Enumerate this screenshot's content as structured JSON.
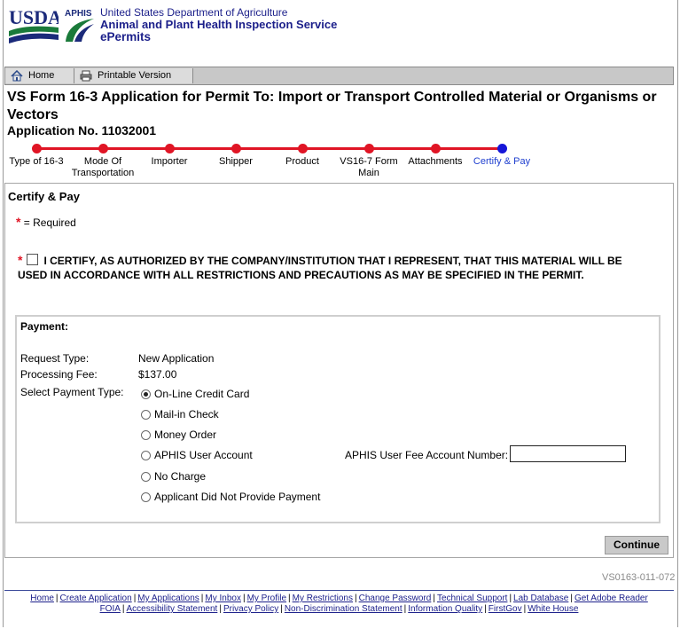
{
  "header": {
    "usda_logo_text": "USDA",
    "aphis_logo_text": "APHIS",
    "line1": "United States Department of Agriculture",
    "line2": "Animal and Plant Health Inspection Service",
    "line3": "ePermits"
  },
  "toolbar": {
    "home_label": "Home",
    "print_label": "Printable Version"
  },
  "page": {
    "title": "VS Form 16-3 Application for Permit To: Import or Transport Controlled Material or Organisms or Vectors",
    "application_no": "Application No. 11032001"
  },
  "steps": [
    {
      "label": "Type of 16-3",
      "current": false
    },
    {
      "label": "Mode Of Transportation",
      "current": false
    },
    {
      "label": "Importer",
      "current": false
    },
    {
      "label": "Shipper",
      "current": false
    },
    {
      "label": "Product",
      "current": false
    },
    {
      "label": "VS16-7 Form Main",
      "current": false
    },
    {
      "label": "Attachments",
      "current": false
    },
    {
      "label": "Certify & Pay",
      "current": true
    }
  ],
  "section": {
    "title": "Certify & Pay",
    "required_star": "*",
    "required_note": "= Required",
    "certify_text": "I CERTIFY, AS AUTHORIZED BY THE COMPANY/INSTITUTION THAT I REPRESENT, THAT THIS MATERIAL WILL BE USED IN ACCORDANCE WITH ALL RESTRICTIONS AND PRECAUTIONS AS MAY BE SPECIFIED IN THE PERMIT.",
    "certify_checked": false
  },
  "payment": {
    "title": "Payment:",
    "request_type_label": "Request Type:",
    "request_type_value": "New Application",
    "fee_label": "Processing Fee:",
    "fee_value": "$137.00",
    "select_label": "Select Payment Type:",
    "options": [
      {
        "label": "On-Line Credit Card",
        "selected": true
      },
      {
        "label": "Mail-in Check",
        "selected": false
      },
      {
        "label": "Money Order",
        "selected": false
      },
      {
        "label": "APHIS User Account",
        "selected": false
      },
      {
        "label": "No Charge",
        "selected": false
      },
      {
        "label": "Applicant Did Not Provide Payment",
        "selected": false
      }
    ],
    "account_label": "APHIS User Fee Account Number:",
    "account_value": ""
  },
  "actions": {
    "continue_label": "Continue"
  },
  "form_code": "VS0163-011-072",
  "footer": {
    "links_line1": [
      "Home",
      "Create Application",
      "My Applications",
      "My Inbox",
      "My Profile",
      "My Restrictions",
      "Change Password",
      "Technical Support",
      "Lab Database",
      "Get Adobe Reader"
    ],
    "links_line2": [
      "FOIA",
      "Accessibility Statement",
      "Privacy Policy",
      "Non-Discrimination Statement",
      "Information Quality",
      "FirstGov",
      "White House"
    ]
  },
  "colors": {
    "agency_blue": "#1b1f8a",
    "progress_red": "#e01525",
    "progress_current": "#1616d8"
  }
}
